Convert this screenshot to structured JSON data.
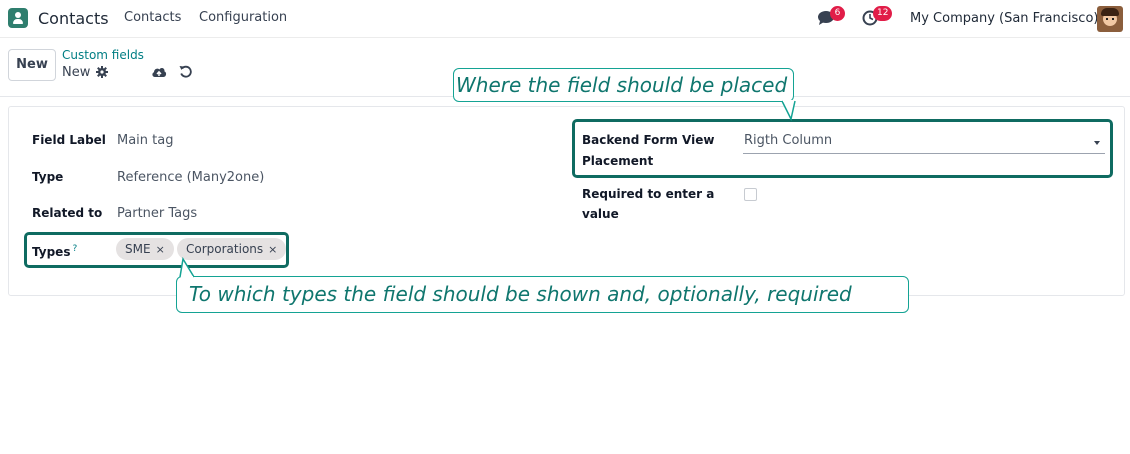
{
  "navbar": {
    "app_name": "Contacts",
    "menu": [
      "Contacts",
      "Configuration"
    ],
    "messages_badge": "6",
    "activities_badge": "12",
    "company": "My Company (San Francisco)"
  },
  "control_panel": {
    "new_button": "New",
    "breadcrumb_parent": "Custom fields",
    "record_name": "New"
  },
  "form": {
    "field_label": {
      "label": "Field Label",
      "value": "Main tag"
    },
    "type": {
      "label": "Type",
      "value": "Reference (Many2one)"
    },
    "related_to": {
      "label": "Related to",
      "value": "Partner Tags"
    },
    "types": {
      "label": "Types",
      "help": "?",
      "tags": [
        "SME",
        "Corporations"
      ],
      "remove_glyph": "×"
    },
    "placement": {
      "label_line1": "Backend Form View",
      "label_line2": "Placement",
      "value": "Rigth Column"
    },
    "required": {
      "label_line1": "Required to enter a",
      "label_line2": "value",
      "checked": false
    }
  },
  "annotations": {
    "top": "Where the field should be placed",
    "bottom": "To which types the field should be shown and, optionally, required"
  },
  "colors": {
    "brand": "#017e84",
    "highlight_border": "#0f6b61",
    "callout_border": "#14a394",
    "badge": "#e11d48"
  }
}
